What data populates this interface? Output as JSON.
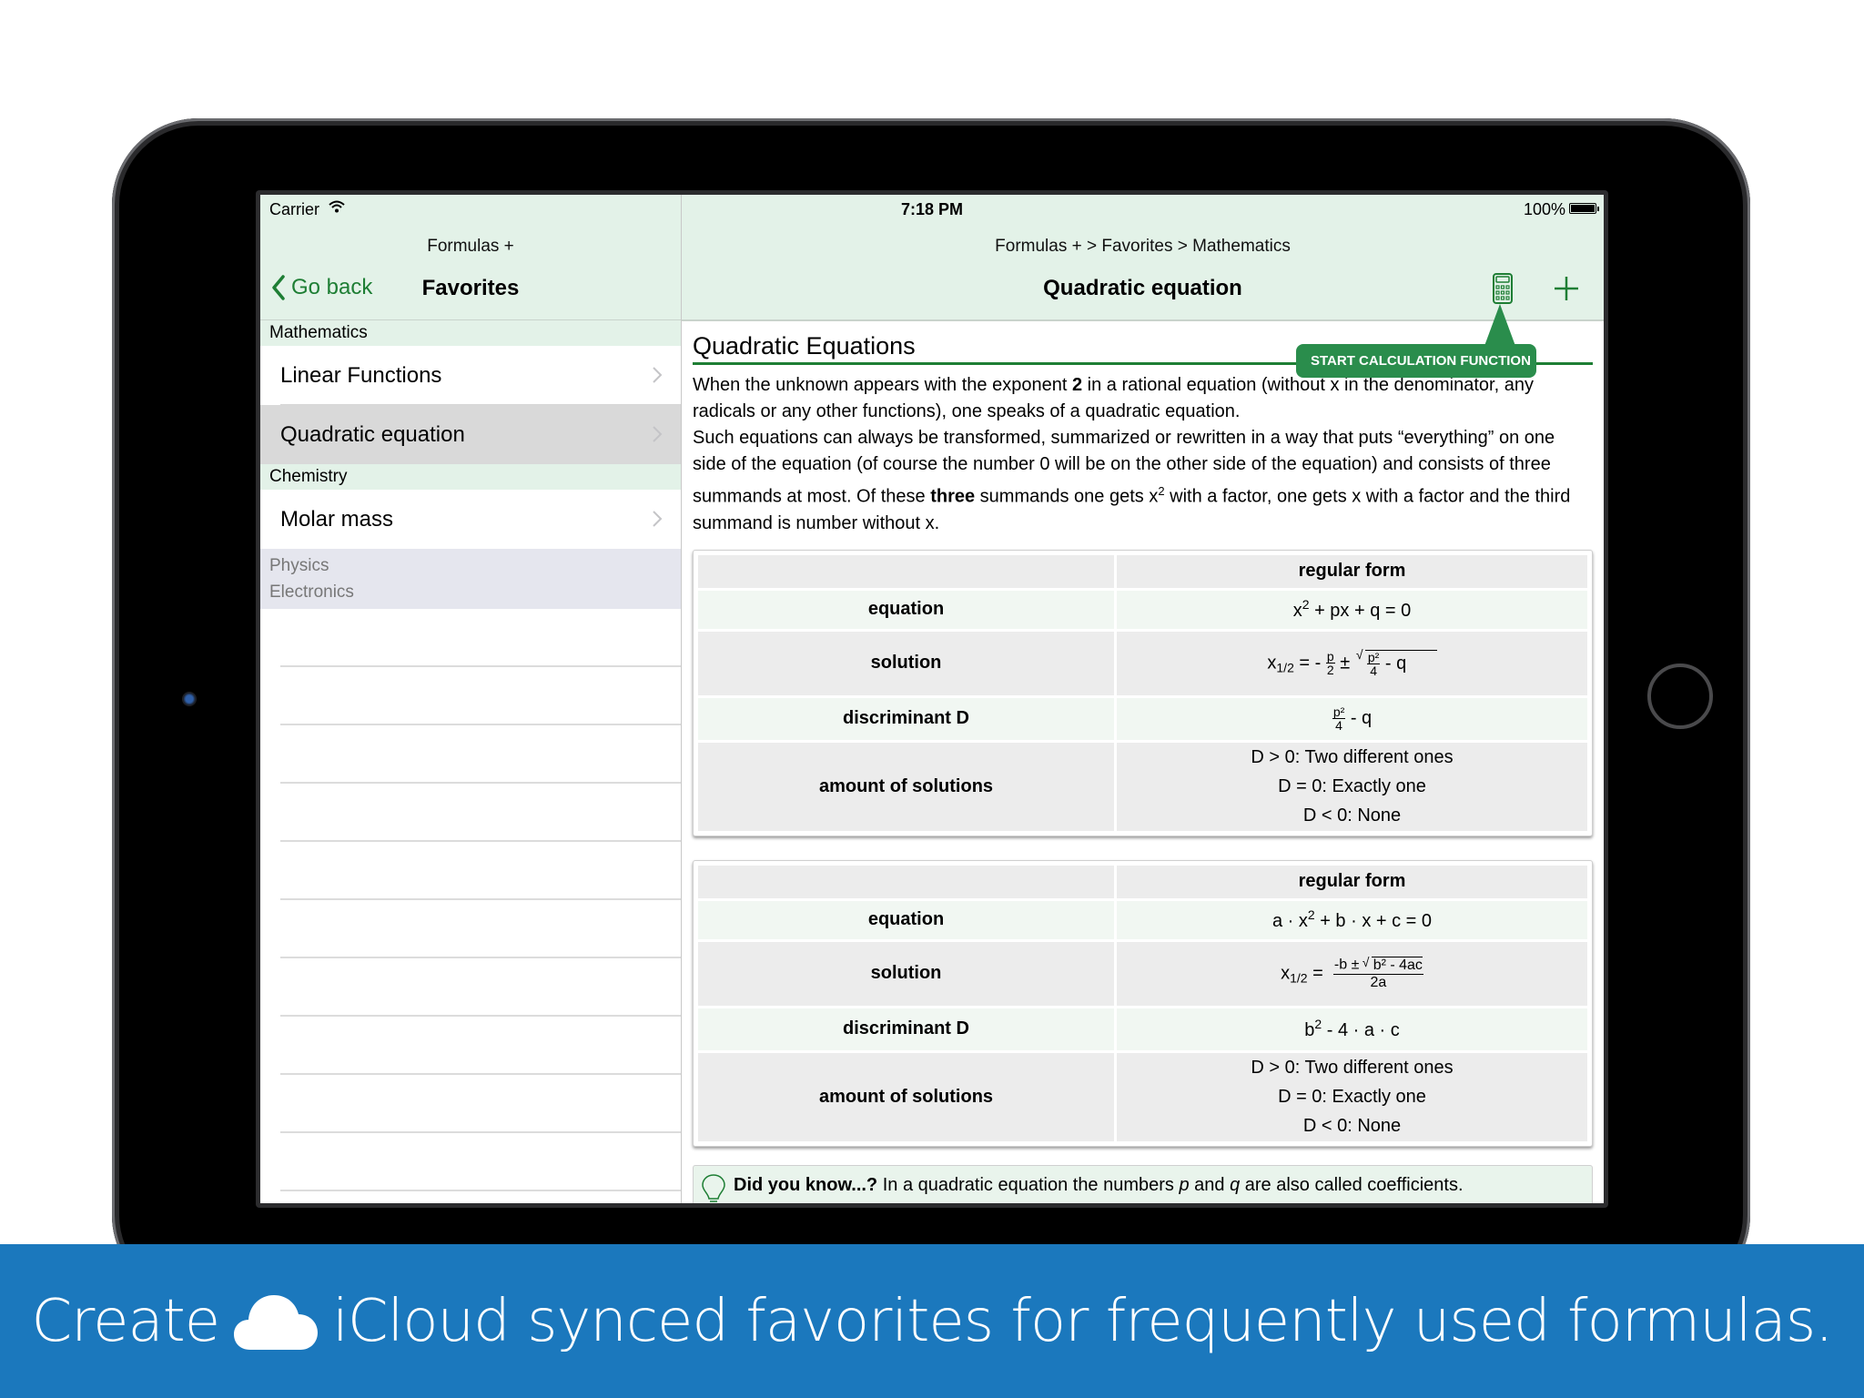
{
  "status_bar": {
    "carrier": "Carrier",
    "time": "7:18 PM",
    "battery": "100%"
  },
  "sidebar": {
    "app_title": "Formulas +",
    "back_label": "Go back",
    "title": "Favorites",
    "sections": [
      {
        "header": "Mathematics",
        "items": [
          {
            "label": "Linear Functions",
            "selected": false
          },
          {
            "label": "Quadratic equation",
            "selected": true
          }
        ]
      },
      {
        "header": "Chemistry",
        "items": [
          {
            "label": "Molar mass",
            "selected": false
          }
        ]
      }
    ],
    "collapsed_sections": [
      "Physics",
      "Electronics"
    ]
  },
  "main": {
    "breadcrumb": "Formulas + > Favorites > Mathematics",
    "title": "Quadratic equation",
    "tooltip": "START CALCULATION FUNCTION",
    "heading": "Quadratic Equations",
    "para1_a": "When the unknown appears with the exponent ",
    "para1_b": "2",
    "para1_c": " in a rational equation (without x in the denominator, any radicals or any other functions), one speaks of a quadratic equation.",
    "para2_a": "Such equations can always be transformed, summarized or rewritten in a way that puts “everything” on one side of the equation (of course the number 0 will be on the other side of the equation) and consists of three summands at most. Of these ",
    "para2_b": "three",
    "para2_c": " summands one gets x",
    "para2_sup": "2",
    "para2_d": " with a factor, one gets x with a factor and the third summand is number without x.",
    "tables": [
      {
        "header": "regular form",
        "rows": {
          "equation_label": "equation",
          "equation": {
            "a": "x",
            "sup": "2",
            "b": " + px + q = 0"
          },
          "solution_label": "solution",
          "solution": {
            "lhs": "x",
            "sub": "1/2",
            "eq": " = - ",
            "f_num": "p",
            "f_den": "2",
            "pm": " ± ",
            "r_num": "p²",
            "r_den": "4",
            "r_tail": " - q"
          },
          "discriminant_label": "discriminant D",
          "discriminant": {
            "num": "p²",
            "den": "4",
            "tail": " - q"
          },
          "amount_label": "amount of solutions",
          "amount": [
            "D > 0: Two different ones",
            "D = 0: Exactly one",
            "D < 0: None"
          ]
        }
      },
      {
        "header": "regular form",
        "rows": {
          "equation_label": "equation",
          "equation": {
            "a": "a · x",
            "sup": "2",
            "b": " + b · x + c = 0"
          },
          "solution_label": "solution",
          "solution": {
            "lhs": "x",
            "sub": "1/2",
            "eq": " = ",
            "num_a": "-b ± ",
            "root": "b² - 4ac",
            "den": "2a"
          },
          "discriminant_label": "discriminant D",
          "discriminant": {
            "a": "b",
            "sup": "2",
            "b": " - 4 · a · c"
          },
          "amount_label": "amount of solutions",
          "amount": [
            "D > 0: Two different ones",
            "D = 0: Exactly one",
            "D < 0: None"
          ]
        }
      }
    ],
    "tip": {
      "bold": "Did you know...?",
      "text_a": " In a quadratic equation the numbers ",
      "p": "p",
      "text_b": " and ",
      "q": "q",
      "text_c": " are also called coefficients."
    }
  },
  "banner": {
    "text_a": "Create",
    "text_b": "iCloud synced favorites for frequently used formulas."
  },
  "colors": {
    "accent_green": "#1e7e34",
    "nav_bg": "#e3f2e8",
    "tooltip_green": "#2a8d4c",
    "banner_blue": "#1b78bd",
    "selected_row": "#d9d9d9"
  }
}
